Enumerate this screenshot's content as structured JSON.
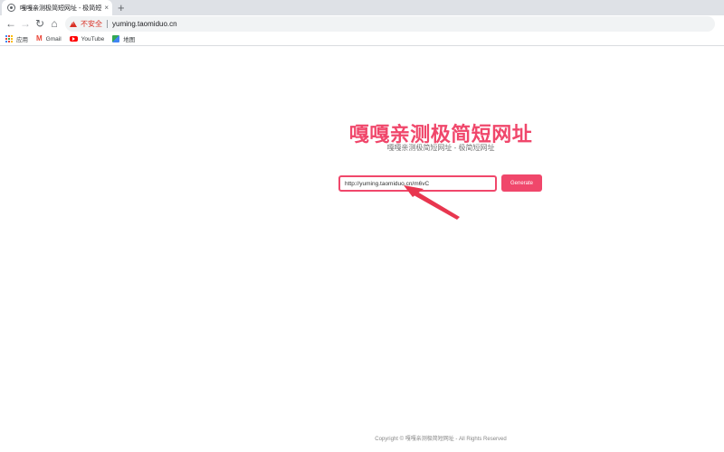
{
  "browser": {
    "tab_title": "嘎嘎亲测极简短网址 - 极简短网址",
    "tab_close": "×",
    "new_tab": "+",
    "nav": {
      "back": "←",
      "forward": "→",
      "reload": "↻",
      "home": "⌂"
    },
    "security_label": "不安全",
    "url": "yuming.taomiduo.cn",
    "bookmarks": [
      {
        "icon": "apps-icon",
        "label": "应用"
      },
      {
        "icon": "gmail-icon",
        "label": "Gmail"
      },
      {
        "icon": "youtube-icon",
        "label": "YouTube"
      },
      {
        "icon": "maps-icon",
        "label": "地图"
      }
    ]
  },
  "page": {
    "title": "嘎嘎亲测极简短网址",
    "subtitle": "嘎嘎亲测极简短网址 - 极简短网址",
    "input_value": "http://yuming.taomiduo.cn/m6vC",
    "generate_label": "Generate",
    "footer": "Copyright © 嘎嘎亲测极简短网址 - All Rights Reserved"
  },
  "colors": {
    "accent": "#f0476b",
    "insecure": "#d93025"
  }
}
